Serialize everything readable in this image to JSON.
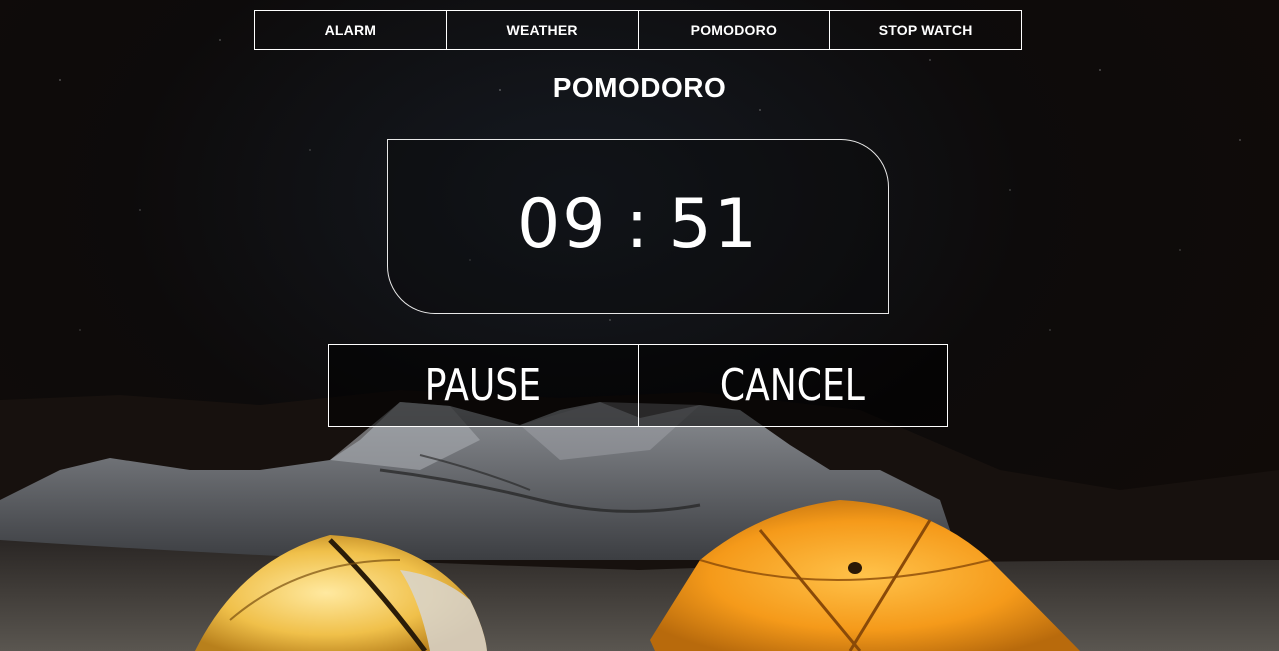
{
  "nav": {
    "items": [
      {
        "label": "ALARM"
      },
      {
        "label": "WEATHER"
      },
      {
        "label": "POMODORO"
      },
      {
        "label": "STOP WATCH"
      }
    ]
  },
  "page": {
    "title": "POMODORO"
  },
  "timer": {
    "minutes": "09",
    "separator": ":",
    "seconds": "51"
  },
  "controls": {
    "pause_label": "PAUSE",
    "cancel_label": "CANCEL"
  },
  "colors": {
    "text": "#ffffff",
    "border": "#ffffff",
    "tent_orange": "#f5a623",
    "sky": "#0d0b0b"
  }
}
